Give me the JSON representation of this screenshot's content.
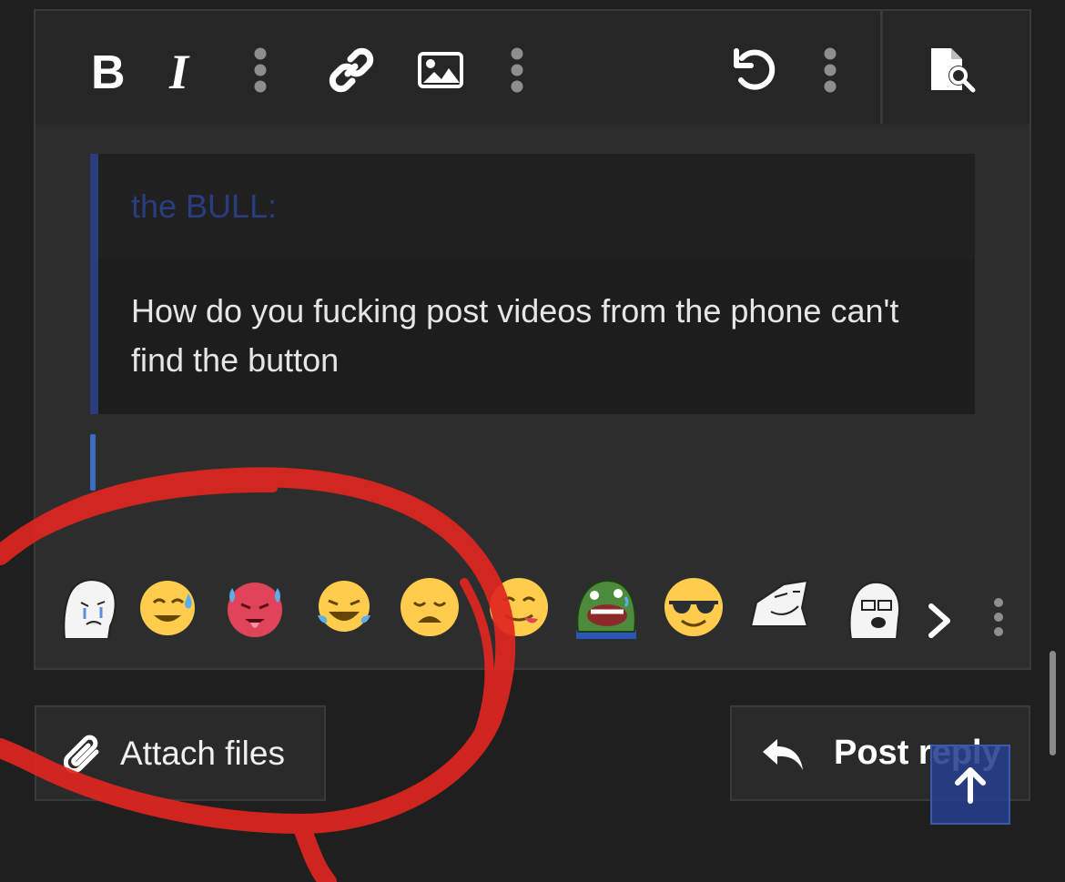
{
  "toolbar": {
    "buttons": [
      {
        "name": "bold",
        "icon": "bold-icon"
      },
      {
        "name": "italic",
        "icon": "italic-icon"
      },
      {
        "name": "more-text-options",
        "icon": "vertical-dots-icon"
      },
      {
        "name": "link",
        "icon": "link-icon"
      },
      {
        "name": "image",
        "icon": "image-icon"
      },
      {
        "name": "more-insert-options",
        "icon": "vertical-dots-icon"
      },
      {
        "name": "undo",
        "icon": "undo-icon"
      },
      {
        "name": "more-options",
        "icon": "vertical-dots-icon"
      },
      {
        "name": "preview",
        "icon": "document-search-icon"
      }
    ]
  },
  "quote": {
    "author": "the BULL:",
    "text": "How do you fucking post videos from the phone can't find the button"
  },
  "emoji_bar": {
    "items": [
      "crying-wojak",
      "sweat-smile",
      "hot-face",
      "tears-of-joy",
      "weary-face",
      "yum-face",
      "laughing-pepe",
      "sunglasses-face",
      "troll-face",
      "soyjak"
    ]
  },
  "actions": {
    "attach_label": "Attach files",
    "reply_label": "Post reply"
  },
  "colors": {
    "background": "#1f1f1f",
    "editor": "#2d2d2d",
    "quote_accent": "#2a3d7d",
    "annotation_red": "#e0261f"
  }
}
